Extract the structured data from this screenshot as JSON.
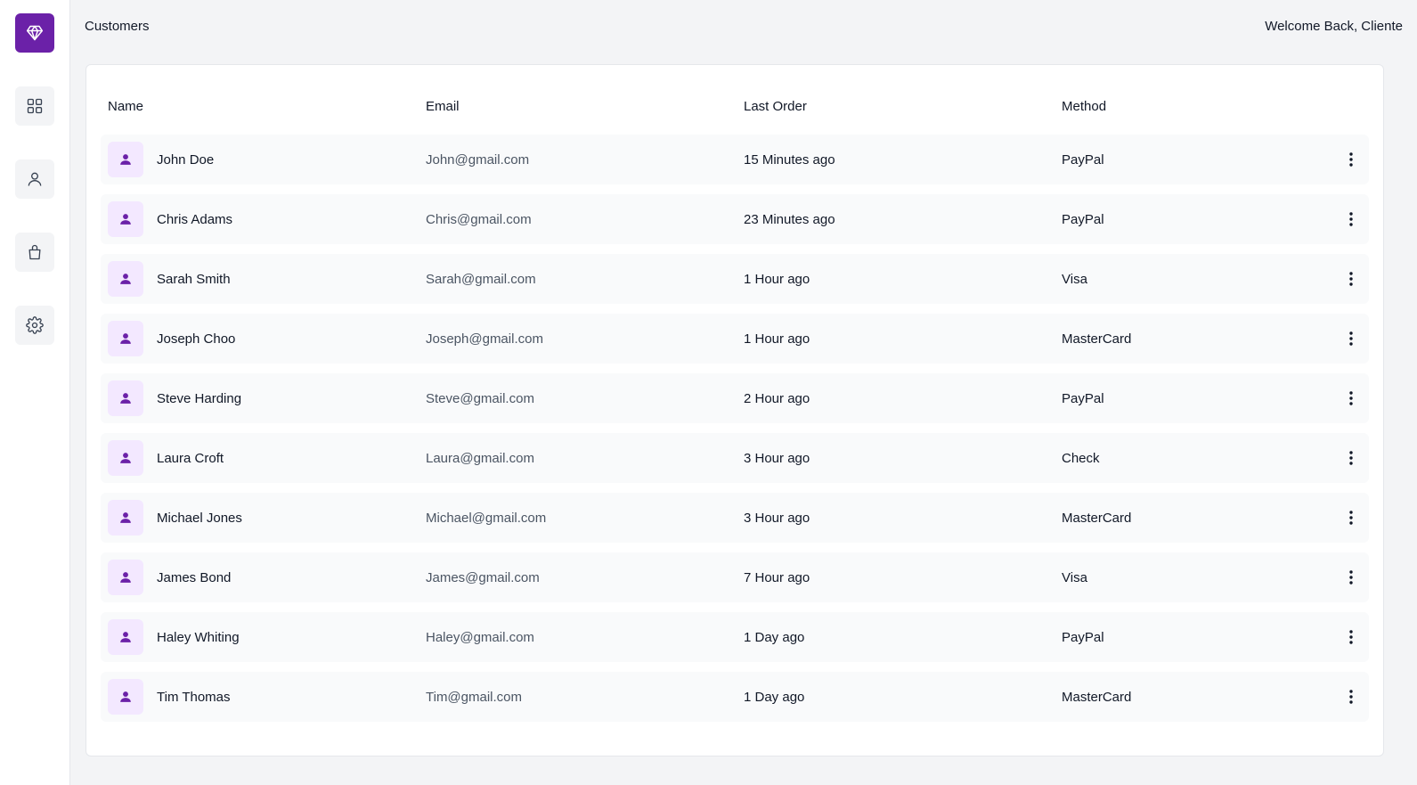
{
  "header": {
    "title": "Customers",
    "welcome": "Welcome Back, Cliente"
  },
  "sidebar": {
    "logo_icon": "diamond-icon",
    "items": [
      {
        "icon": "dashboard-grid-icon"
      },
      {
        "icon": "user-icon"
      },
      {
        "icon": "shopping-bag-icon"
      },
      {
        "icon": "gear-icon"
      }
    ]
  },
  "table": {
    "columns": [
      "Name",
      "Email",
      "Last Order",
      "Method"
    ],
    "rows": [
      {
        "name": "John Doe",
        "email": "John@gmail.com",
        "last_order": "15 Minutes ago",
        "method": "PayPal"
      },
      {
        "name": "Chris Adams",
        "email": "Chris@gmail.com",
        "last_order": "23 Minutes ago",
        "method": "PayPal"
      },
      {
        "name": "Sarah Smith",
        "email": "Sarah@gmail.com",
        "last_order": "1 Hour ago",
        "method": "Visa"
      },
      {
        "name": "Joseph Choo",
        "email": "Joseph@gmail.com",
        "last_order": "1 Hour ago",
        "method": "MasterCard"
      },
      {
        "name": "Steve Harding",
        "email": "Steve@gmail.com",
        "last_order": "2 Hour ago",
        "method": "PayPal"
      },
      {
        "name": "Laura Croft",
        "email": "Laura@gmail.com",
        "last_order": "3 Hour ago",
        "method": "Check"
      },
      {
        "name": "Michael Jones",
        "email": "Michael@gmail.com",
        "last_order": "3 Hour ago",
        "method": "MasterCard"
      },
      {
        "name": "James Bond",
        "email": "James@gmail.com",
        "last_order": "7 Hour ago",
        "method": "Visa"
      },
      {
        "name": "Haley Whiting",
        "email": "Haley@gmail.com",
        "last_order": "1 Day ago",
        "method": "PayPal"
      },
      {
        "name": "Tim Thomas",
        "email": "Tim@gmail.com",
        "last_order": "1 Day ago",
        "method": "MasterCard"
      }
    ]
  },
  "colors": {
    "accent": "#6b21a8",
    "avatar_bg": "#f3e8ff",
    "row_bg": "#f9fafb",
    "page_bg": "#f3f4f6"
  }
}
